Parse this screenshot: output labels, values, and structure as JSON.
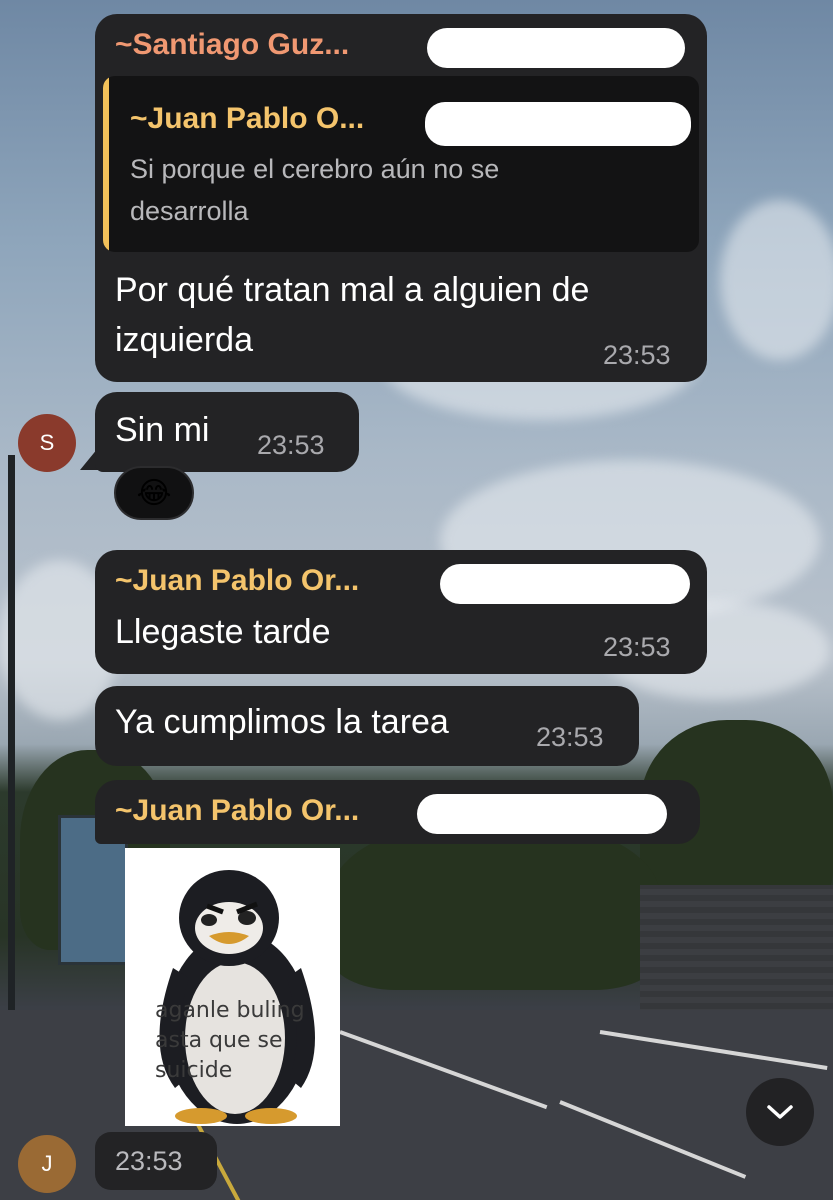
{
  "colors": {
    "bubble": "#232325",
    "sender_orange": "#f09872",
    "sender_yellow": "#f4c46c",
    "quote_bar": "#f2c15a",
    "time": "#a9a9ad",
    "avatar_s": "#8a3a2c",
    "avatar_j": "#9a6a34"
  },
  "messages": {
    "m1": {
      "sender": "~Santiago Guz...",
      "quote_sender": "~Juan Pablo O...",
      "quote_line1": "Si porque el cerebro aún no se",
      "quote_line2": "desarrolla",
      "line1": "Por qué tratan mal a alguien de",
      "line2": "izquierda",
      "time": "23:53"
    },
    "m2": {
      "avatar_letter": "S",
      "text": "Sin mi",
      "time": "23:53",
      "reaction": "😂",
      "reaction_icon": "face-with-tears-of-joy"
    },
    "m3": {
      "sender": "~Juan Pablo Or...",
      "text": "Llegaste tarde",
      "time": "23:53"
    },
    "m4": {
      "text": "Ya cumplimos la tarea",
      "time": "23:53"
    },
    "m5": {
      "sender": "~Juan Pablo Or...",
      "sticker_text_line1": "aganle buling",
      "sticker_text_line2": "asta que se",
      "sticker_text_line3": "suicide",
      "avatar_letter": "J",
      "time": "23:53"
    }
  },
  "scroll_button": {
    "icon": "chevron-down-icon"
  }
}
